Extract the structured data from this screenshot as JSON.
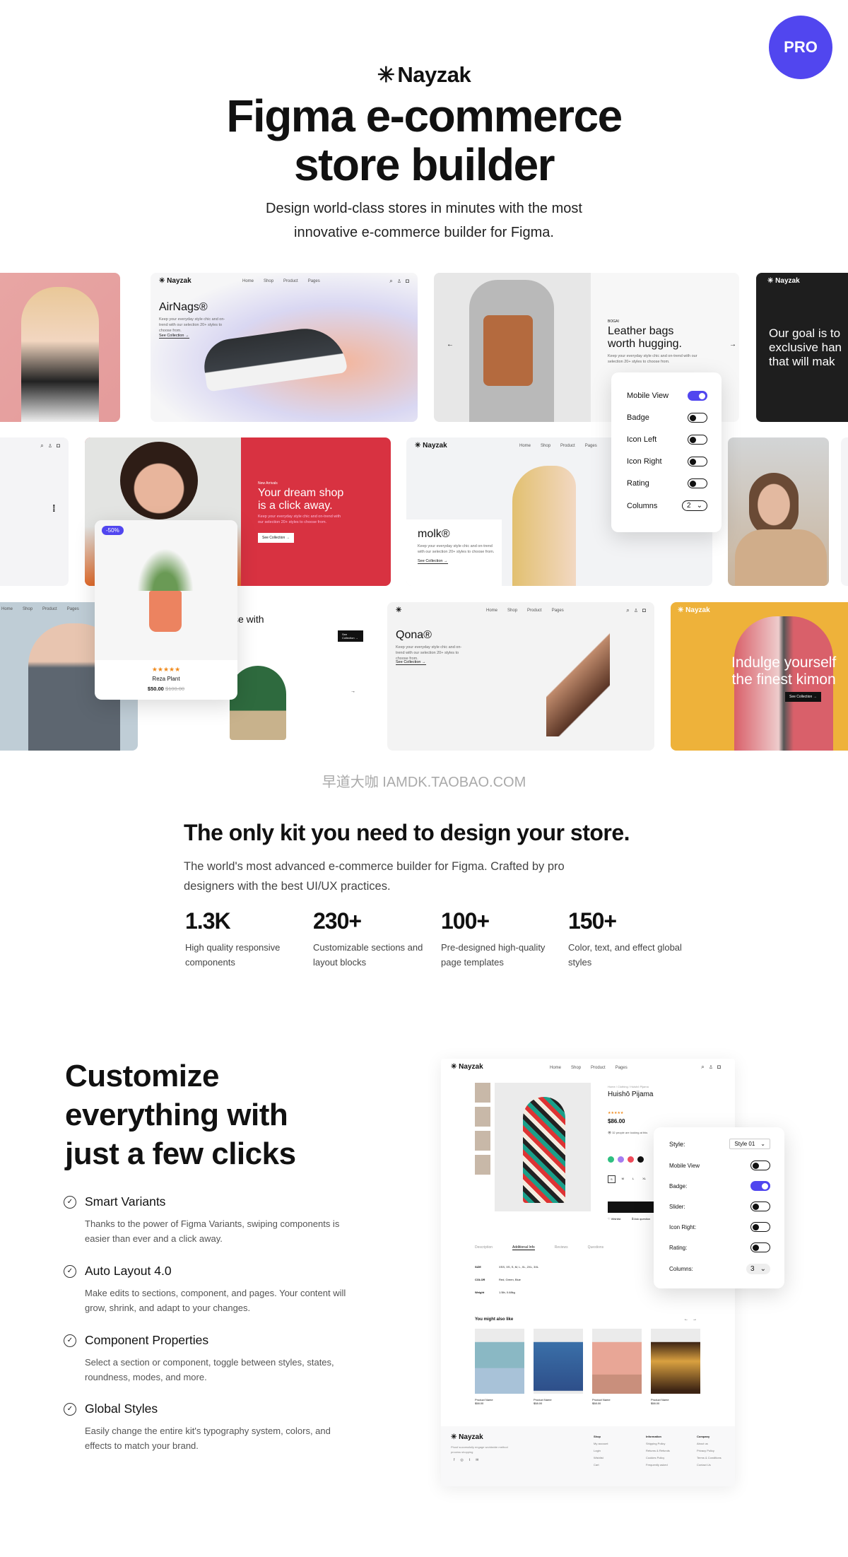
{
  "badge": {
    "label": "PRO",
    "color": "#5146ef"
  },
  "brand": {
    "name": "Nayzak",
    "icon": "asterisk-logo-icon"
  },
  "hero": {
    "title_line1": "Figma e-commerce",
    "title_line2": "store builder",
    "subtitle_line1": "Design world-class stores in minutes with the most",
    "subtitle_line2": "innovative e-commerce builder for Figma."
  },
  "nav": {
    "home": "Home",
    "shop": "Shop",
    "product": "Product",
    "pages": "Pages"
  },
  "collage": {
    "airnags": {
      "title": "AirNags®",
      "desc": "Keep your everyday style chic and on-trend with our selection 20+ styles to choose from.",
      "link": "See Collection →"
    },
    "bags": {
      "eyebrow": "BOGAI",
      "title_line1": "Leather bags",
      "title_line2": "worth hugging.",
      "desc": "Keep your everyday style chic and on-trend with our selection 20+ styles to choose from."
    },
    "dark": {
      "line1": "Our goal is to",
      "line2": "exclusive han",
      "line3": "that will mak"
    },
    "settings1": {
      "rows": [
        {
          "label": "Mobile View",
          "on": true
        },
        {
          "label": "Badge",
          "on": false
        },
        {
          "label": "Icon Left",
          "on": false
        },
        {
          "label": "Icon Right",
          "on": false
        },
        {
          "label": "Rating",
          "on": false
        }
      ],
      "columns_label": "Columns",
      "columns_value": "2"
    },
    "dream": {
      "eyebrow": "New Arrivals",
      "title_line1": "Your dream shop",
      "title_line2": "is a click away.",
      "desc": "Keep your everyday style chic and on-trend with our selection 20+ styles to choose from.",
      "button": "See Collection →",
      "color": "#d83241"
    },
    "molk": {
      "title": "molk®",
      "desc": "Keep your everyday style chic and on-trend with our selection 20+ styles to choose from.",
      "link": "See Collection →"
    },
    "plant": {
      "badge": "-50%",
      "stars": "★★★★★",
      "name": "Reza Plant",
      "price": "$50.00",
      "old_price": "$100.00"
    },
    "succulent": {
      "title": "se with",
      "button": "See Collection →"
    },
    "qona": {
      "title": "Qona®",
      "desc": "Keep your everyday style chic and on-trend with our selection 20+ styles to choose from.",
      "link": "See Collection →"
    },
    "kimono": {
      "title_line1": "Indulge yourself",
      "title_line2": "the finest kimon",
      "button": "See Collection →",
      "color": "#eeb23a"
    }
  },
  "watermark": "早道大咖  IAMDK.TAOBAO.COM",
  "kit": {
    "title": "The only kit you need to design your store.",
    "desc": "The world's most advanced e-commerce builder for Figma. Crafted by pro designers with the best UI/UX practices.",
    "stats": [
      {
        "value": "1.3K",
        "label": "High quality responsive components"
      },
      {
        "value": "230+",
        "label": "Customizable sections and layout blocks"
      },
      {
        "value": "100+",
        "label": "Pre-designed high-quality page templates"
      },
      {
        "value": "150+",
        "label": "Color, text, and effect global styles"
      }
    ]
  },
  "customize": {
    "title_line1": "Customize",
    "title_line2": "everything with",
    "title_line3": "just a few clicks",
    "features": [
      {
        "title": "Smart Variants",
        "desc": "Thanks to the power of Figma Variants, swiping components is easier than ever and a click away."
      },
      {
        "title": "Auto Layout 4.0",
        "desc": "Make edits to sections, component, and pages. Your content will grow, shrink, and adapt to your changes."
      },
      {
        "title": "Component Properties",
        "desc": "Select a section or component, toggle between styles, states, roundness, modes, and more."
      },
      {
        "title": "Global Styles",
        "desc": "Easily change the entire kit's typography system, colors, and effects to match your brand."
      }
    ]
  },
  "product_page": {
    "breadcrumb": "Home / Clothing / Huishō Pijama",
    "name": "Huishō Pijama",
    "stars": "★★★★★",
    "price": "$86.00",
    "viewers": "32 people are looking at this",
    "sizes": [
      "S",
      "M",
      "L",
      "XL"
    ],
    "swatches": [
      "#2fbf80",
      "#a47cf0",
      "#ef4b5a",
      "#111111"
    ],
    "add_button": "Add to cart",
    "wishlist": "Wishlist",
    "ask": "Ask question",
    "tabs": [
      "Description",
      "Additional Info",
      "Reviews",
      "Questions"
    ],
    "info": [
      {
        "k": "SIZE",
        "v": "XSS, XS, S, M, L, XL, 2XL, 3XL"
      },
      {
        "k": "COLOR",
        "v": "Red, Green, Blue"
      },
      {
        "k": "Weight",
        "v": "1.5lb, 0.68kg"
      }
    ],
    "related_title": "You might also like",
    "related": [
      {
        "name": "Product Name",
        "price": "$58.00"
      },
      {
        "name": "Product Name",
        "price": "$58.00"
      },
      {
        "name": "Product Name",
        "price": "$58.00"
      },
      {
        "name": "Product Name",
        "price": "$58.00"
      }
    ],
    "footer": {
      "tagline": "Phosf successfully engage worldwide method process shopping",
      "cols": [
        {
          "title": "Shop",
          "items": [
            "My account",
            "Login",
            "Wishlist",
            "Cart"
          ]
        },
        {
          "title": "Information",
          "items": [
            "Shipping Policy",
            "Returns & Refunds",
            "Cookies Policy",
            "Frequently asked"
          ]
        },
        {
          "title": "Company",
          "items": [
            "About us",
            "Privacy Policy",
            "Terms & Conditions",
            "Contact Us"
          ]
        }
      ]
    },
    "settings": {
      "style_label": "Style:",
      "style_value": "Style 01",
      "rows": [
        {
          "label": "Mobile View",
          "on": false
        },
        {
          "label": "Badge:",
          "on": true
        },
        {
          "label": "Slider:",
          "on": false
        },
        {
          "label": "Icon Right:",
          "on": false
        },
        {
          "label": "Rating:",
          "on": false
        }
      ],
      "columns_label": "Columns:",
      "columns_value": "3"
    }
  }
}
